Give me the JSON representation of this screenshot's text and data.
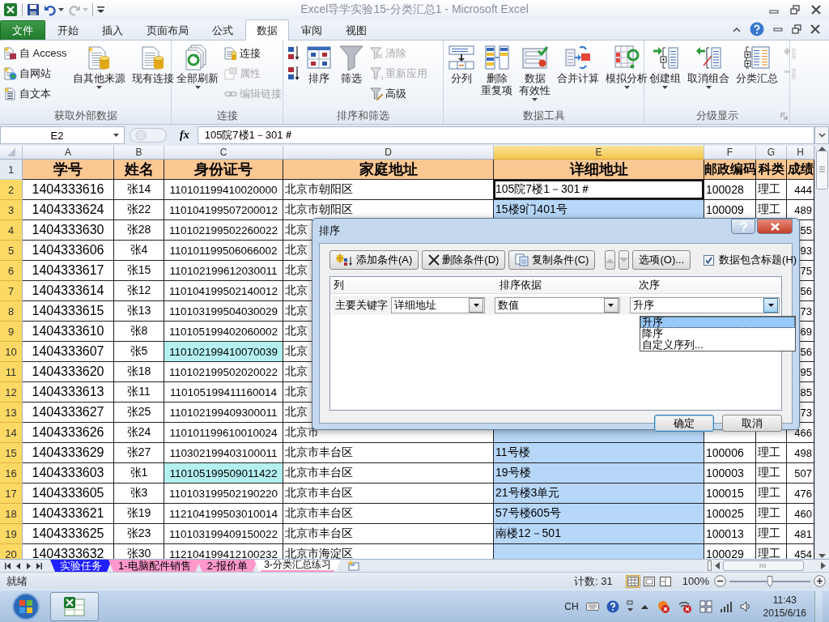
{
  "title_bar": {
    "title": "Excel导学实验15-分类汇总1 - Microsoft Excel"
  },
  "ribbon_tabs": [
    {
      "label": "文件",
      "kind": "file",
      "selected": false
    },
    {
      "label": "开始",
      "kind": "tab",
      "selected": false
    },
    {
      "label": "插入",
      "kind": "tab",
      "selected": false
    },
    {
      "label": "页面布局",
      "kind": "tab",
      "selected": false
    },
    {
      "label": "公式",
      "kind": "tab",
      "selected": false
    },
    {
      "label": "数据",
      "kind": "tab",
      "selected": true
    },
    {
      "label": "审阅",
      "kind": "tab",
      "selected": false
    },
    {
      "label": "视图",
      "kind": "tab",
      "selected": false
    }
  ],
  "ribbon_groups": [
    {
      "label": "获取外部数据",
      "launcher": false,
      "items": [
        {
          "label": "自 Access",
          "kind": "small",
          "disabled": false,
          "dropdown": false
        },
        {
          "label": "自网站",
          "kind": "small",
          "disabled": false,
          "dropdown": false
        },
        {
          "label": "自文本",
          "kind": "small",
          "disabled": false,
          "dropdown": false
        },
        {
          "label": "自其他来源",
          "kind": "large",
          "disabled": false,
          "dropdown": true
        },
        {
          "label": "现有连接",
          "kind": "large",
          "disabled": false,
          "dropdown": false
        }
      ]
    },
    {
      "label": "连接",
      "launcher": false,
      "items": [
        {
          "label": "全部刷新",
          "kind": "large",
          "disabled": false,
          "dropdown": true
        },
        {
          "label": "连接",
          "kind": "small",
          "disabled": false,
          "dropdown": false
        },
        {
          "label": "属性",
          "kind": "small",
          "disabled": true,
          "dropdown": false
        },
        {
          "label": "编辑链接",
          "kind": "small",
          "disabled": true,
          "dropdown": false
        }
      ]
    },
    {
      "label": "排序和筛选",
      "launcher": false,
      "items": [
        {
          "kind": "icon",
          "disabled": false,
          "dropdown": false
        },
        {
          "kind": "icon",
          "disabled": false,
          "dropdown": false
        },
        {
          "label": "排序",
          "kind": "large",
          "disabled": false,
          "dropdown": false
        },
        {
          "label": "筛选",
          "kind": "large",
          "disabled": false,
          "dropdown": false
        },
        {
          "label": "清除",
          "kind": "small",
          "disabled": true,
          "dropdown": false
        },
        {
          "label": "重新应用",
          "kind": "small",
          "disabled": true,
          "dropdown": false
        },
        {
          "label": "高级",
          "kind": "small",
          "disabled": false,
          "dropdown": false
        }
      ]
    },
    {
      "label": "数据工具",
      "launcher": false,
      "items": [
        {
          "label": "分列",
          "kind": "large",
          "disabled": false,
          "dropdown": false
        },
        {
          "label": [
            "删除",
            "重复项"
          ],
          "kind": "large",
          "disabled": false,
          "dropdown": false
        },
        {
          "label": [
            "数据",
            "有效性"
          ],
          "kind": "large",
          "disabled": false,
          "dropdown": true
        },
        {
          "label": "合并计算",
          "kind": "large",
          "disabled": false,
          "dropdown": false
        },
        {
          "label": "模拟分析",
          "kind": "large",
          "disabled": false,
          "dropdown": true
        }
      ]
    },
    {
      "label": "分级显示",
      "launcher": true,
      "items": [
        {
          "label": "创建组",
          "kind": "large",
          "disabled": false,
          "dropdown": true
        },
        {
          "label": "取消组合",
          "kind": "large",
          "disabled": false,
          "dropdown": true
        },
        {
          "label": "分类汇总",
          "kind": "large",
          "disabled": false,
          "dropdown": false
        },
        {
          "kind": "icon",
          "disabled": true,
          "dropdown": false
        },
        {
          "kind": "icon",
          "disabled": true,
          "dropdown": false
        }
      ]
    }
  ],
  "formula_bar": {
    "name_box": "E2",
    "function_label": "fx",
    "content": "105院7楼1－301＃"
  },
  "sheet": {
    "columns": [
      {
        "label": "A",
        "selected": false
      },
      {
        "label": "B",
        "selected": false
      },
      {
        "label": "C",
        "selected": false
      },
      {
        "label": "D",
        "selected": false
      },
      {
        "label": "E",
        "selected": true
      },
      {
        "label": "F",
        "selected": false
      },
      {
        "label": "G",
        "selected": false
      },
      {
        "label": "H",
        "selected": false
      }
    ],
    "rows": [
      {
        "number": "1",
        "kind": "header",
        "selected": false,
        "highlighted": false,
        "cells": {
          "A": "学号",
          "B": "姓名",
          "C": "身份证号",
          "D": "家庭地址",
          "E": "详细地址",
          "F": "邮政编码",
          "G": "科类",
          "H": "成绩"
        }
      },
      {
        "number": "2",
        "kind": "data",
        "selected": true,
        "highlighted": false,
        "cells": {
          "A": "1404333616",
          "B": "张14",
          "C": "110101199410020000",
          "D": "北京市朝阳区",
          "E": "105院7楼1－301＃",
          "F": "100028",
          "G": "理工",
          "H": "444"
        }
      },
      {
        "number": "3",
        "kind": "data",
        "selected": true,
        "highlighted": false,
        "cells": {
          "A": "1404333624",
          "B": "张22",
          "C": "110104199507200012",
          "D": "北京市朝阳区",
          "E": "15楼9门401号",
          "F": "100009",
          "G": "理工",
          "H": "489"
        }
      },
      {
        "number": "4",
        "kind": "data",
        "selected": true,
        "highlighted": false,
        "cells": {
          "A": "1404333630",
          "B": "张28",
          "C": "110102199502260022",
          "D": "北京",
          "H": "55"
        }
      },
      {
        "number": "5",
        "kind": "data",
        "selected": true,
        "highlighted": false,
        "cells": {
          "A": "1404333606",
          "B": "张4",
          "C": "110101199506066002",
          "D": "北京",
          "H": "93"
        }
      },
      {
        "number": "6",
        "kind": "data",
        "selected": true,
        "highlighted": false,
        "cells": {
          "A": "1404333617",
          "B": "张15",
          "C": "110102199612030011",
          "D": "北京",
          "H": "75"
        }
      },
      {
        "number": "7",
        "kind": "data",
        "selected": true,
        "highlighted": false,
        "cells": {
          "A": "1404333614",
          "B": "张12",
          "C": "110104199502140012",
          "D": "北京",
          "H": "56"
        }
      },
      {
        "number": "8",
        "kind": "data",
        "selected": true,
        "highlighted": false,
        "cells": {
          "A": "1404333615",
          "B": "张13",
          "C": "110103199504030029",
          "D": "北京",
          "H": "73"
        }
      },
      {
        "number": "9",
        "kind": "data",
        "selected": true,
        "highlighted": false,
        "cells": {
          "A": "1404333610",
          "B": "张8",
          "C": "110105199402060002",
          "D": "北京",
          "H": "69"
        }
      },
      {
        "number": "10",
        "kind": "data",
        "selected": true,
        "highlighted": true,
        "cells": {
          "A": "1404333607",
          "B": "张5",
          "C": "110102199410070039",
          "D": "北京",
          "H": "56"
        }
      },
      {
        "number": "11",
        "kind": "data",
        "selected": true,
        "highlighted": false,
        "cells": {
          "A": "1404333620",
          "B": "张18",
          "C": "110102199502020022",
          "D": "北京",
          "H": "95"
        }
      },
      {
        "number": "12",
        "kind": "data",
        "selected": true,
        "highlighted": false,
        "cells": {
          "A": "1404333613",
          "B": "张11",
          "C": "110105199411160014",
          "D": "北京",
          "H": "85"
        }
      },
      {
        "number": "13",
        "kind": "data",
        "selected": true,
        "highlighted": false,
        "cells": {
          "A": "1404333627",
          "B": "张25",
          "C": "110102199409300011",
          "D": "北京",
          "H": "73"
        }
      },
      {
        "number": "14",
        "kind": "data",
        "selected": true,
        "highlighted": false,
        "cells": {
          "A": "1404333626",
          "B": "张24",
          "C": "110101199610010024",
          "D": "北京市",
          "H": "466"
        }
      },
      {
        "number": "15",
        "kind": "data",
        "selected": true,
        "highlighted": false,
        "cells": {
          "A": "1404333629",
          "B": "张27",
          "C": "110302199403100011",
          "D": "北京市丰台区",
          "E": "11号楼",
          "F": "100006",
          "G": "理工",
          "H": "498"
        }
      },
      {
        "number": "16",
        "kind": "data",
        "selected": true,
        "highlighted": true,
        "cells": {
          "A": "1404333603",
          "B": "张1",
          "C": "110105199509011422",
          "D": "北京市丰台区",
          "E": "19号楼",
          "F": "100003",
          "G": "理工",
          "H": "507"
        }
      },
      {
        "number": "17",
        "kind": "data",
        "selected": true,
        "highlighted": false,
        "cells": {
          "A": "1404333605",
          "B": "张3",
          "C": "110103199502190220",
          "D": "北京市丰台区",
          "E": "21号楼3单元",
          "F": "100015",
          "G": "理工",
          "H": "476"
        }
      },
      {
        "number": "18",
        "kind": "data",
        "selected": true,
        "highlighted": false,
        "cells": {
          "A": "1404333621",
          "B": "张19",
          "C": "112104199503010014",
          "D": "北京市丰台区",
          "E": "57号楼605号",
          "F": "100025",
          "G": "理工",
          "H": "460"
        }
      },
      {
        "number": "19",
        "kind": "data",
        "selected": true,
        "highlighted": false,
        "cells": {
          "A": "1404333625",
          "B": "张23",
          "C": "110103199409150022",
          "D": "北京市丰台区",
          "E": "南楼12－501",
          "F": "100013",
          "G": "理工",
          "H": "481"
        }
      },
      {
        "number": "20",
        "kind": "data",
        "selected": true,
        "highlighted": false,
        "cells": {
          "A": "1404333632",
          "B": "张30",
          "C": "112104199412100232",
          "D": "北京市海淀区",
          "F": "100029",
          "G": "理工",
          "H": "454"
        }
      }
    ]
  },
  "sheet_tabs": [
    {
      "label": "实验任务",
      "selected": false,
      "color": "#1f1fff"
    },
    {
      "label": "1-电脑配件销售",
      "selected": false,
      "color": "#ff99cc"
    },
    {
      "label": "2-报价单",
      "selected": false,
      "color": "#ff99cc"
    },
    {
      "label": "3-分类汇总练习",
      "selected": true,
      "color": "#ff99cc"
    }
  ],
  "status_bar": {
    "state": "就绪",
    "count": "计数: 31",
    "views": [
      {
        "selected": true
      },
      {
        "selected": false
      },
      {
        "selected": false
      }
    ],
    "zoom": "100%",
    "zoom_slider": {
      "level": 0.5
    }
  },
  "sort_dialog": {
    "title": "排序",
    "toolbar": [
      {
        "kind": "add",
        "label": "添加条件(A)",
        "disabled": false
      },
      {
        "kind": "delete",
        "label": "删除条件(D)",
        "disabled": false
      },
      {
        "kind": "copy",
        "label": "复制条件(C)",
        "disabled": false
      },
      {
        "kind": "up",
        "disabled": true
      },
      {
        "kind": "down",
        "disabled": true
      },
      {
        "kind": "options",
        "label": "选项(O)...",
        "disabled": false
      }
    ],
    "header_checkbox": {
      "label": "数据包含标题(H)",
      "checked": true
    },
    "columns": [
      "列",
      "排序依据",
      "次序"
    ],
    "levels": [
      {
        "label": "主要关键字",
        "column": "详细地址",
        "sort_on": "数值",
        "order": "升序",
        "order_open": true
      }
    ],
    "order_options": [
      {
        "label": "升序",
        "selected": true
      },
      {
        "label": "降序",
        "selected": false
      },
      {
        "label": "自定义序列...",
        "selected": false
      }
    ],
    "buttons": [
      {
        "label": "确定",
        "default": true
      },
      {
        "label": "取消",
        "default": false
      }
    ]
  },
  "taskbar": {
    "apps": [
      {
        "active": true
      }
    ],
    "language": "CH",
    "time": "11:43",
    "date": "2015/6/16"
  }
}
